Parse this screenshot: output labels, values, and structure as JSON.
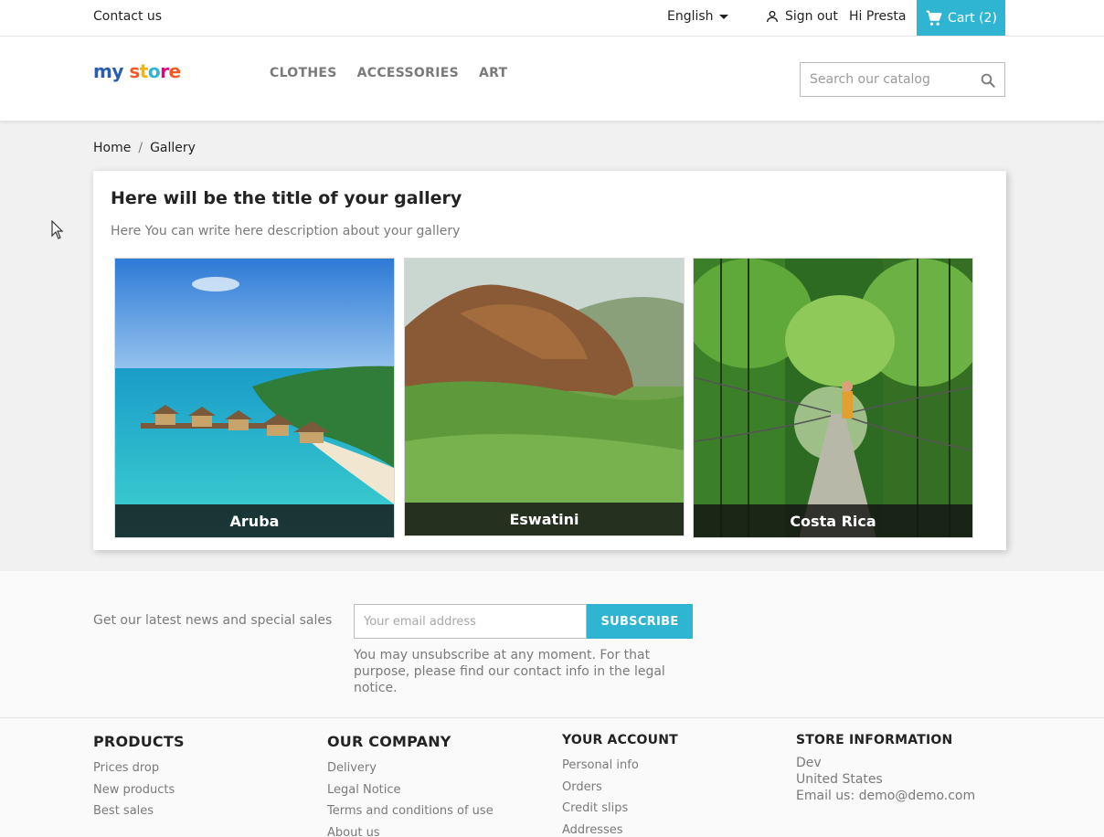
{
  "topbar": {
    "contact": "Contact us",
    "language": "English",
    "sign_out": "Sign out",
    "greeting": "Hi Presta",
    "cart": "Cart (2)"
  },
  "header": {
    "logo": {
      "word1": "my",
      "word2": "store"
    },
    "nav": [
      "CLOTHES",
      "ACCESSORIES",
      "ART"
    ],
    "search_placeholder": "Search our catalog"
  },
  "breadcrumb": {
    "home": "Home",
    "separator": "/",
    "current": "Gallery"
  },
  "gallery": {
    "title": "Here will be the title of your gallery",
    "description": "Here You can write here description about your gallery",
    "items": [
      {
        "caption": "Aruba"
      },
      {
        "caption": "Eswatini"
      },
      {
        "caption": "Costa Rica"
      }
    ]
  },
  "newsletter": {
    "lead": "Get our latest news and special sales",
    "email_placeholder": "Your email address",
    "subscribe": "SUBSCRIBE",
    "note": "You may unsubscribe at any moment. For that purpose, please find our contact info in the legal notice."
  },
  "footer": {
    "products": {
      "title": "PRODUCTS",
      "links": [
        "Prices drop",
        "New products",
        "Best sales"
      ]
    },
    "company": {
      "title": "OUR COMPANY",
      "links": [
        "Delivery",
        "Legal Notice",
        "Terms and conditions of use",
        "About us"
      ]
    },
    "account": {
      "title": "YOUR ACCOUNT",
      "links": [
        "Personal info",
        "Orders",
        "Credit slips",
        "Addresses"
      ]
    },
    "store": {
      "title": "STORE INFORMATION",
      "lines": [
        "Dev",
        "United States",
        "Email us: demo@demo.com"
      ]
    }
  },
  "colors": {
    "accent": "#2fb5d2",
    "text": "#232323",
    "muted": "#7a7a7a",
    "background": "#f1f1f1"
  }
}
